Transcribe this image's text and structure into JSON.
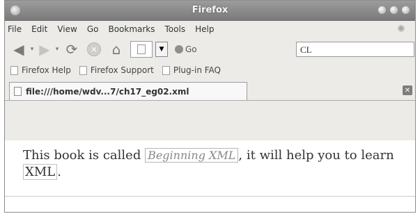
{
  "window": {
    "title": "Firefox"
  },
  "menu": [
    "File",
    "Edit",
    "View",
    "Go",
    "Bookmarks",
    "Tools",
    "Help"
  ],
  "toolbar": {
    "go_label": "Go",
    "search_value": "CL"
  },
  "bookmarks": [
    "Firefox Help",
    "Firefox Support",
    "Plug-in FAQ"
  ],
  "tab": {
    "title": "file:///home/wdv...7/ch17_eg02.xml"
  },
  "content": {
    "text_before": "This book is called ",
    "book_title": "Beginning XML",
    "text_middle": ", it will help you to learn ",
    "xml_term": "XML",
    "text_after": "."
  }
}
